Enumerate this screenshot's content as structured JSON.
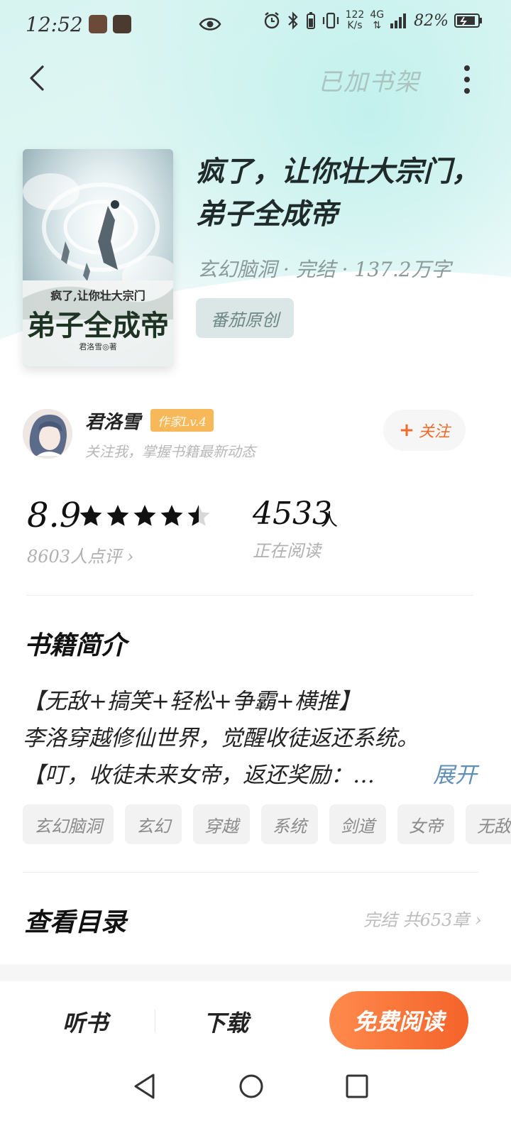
{
  "status_bar": {
    "time": "12:52",
    "speed_value": "122",
    "speed_unit": "K/s",
    "network": "4G",
    "battery": "82%"
  },
  "nav": {
    "shelf_label": "已加书架"
  },
  "book": {
    "title": "疯了，让你壮大宗门，弟子全成帝",
    "meta": "玄幻脑洞 · 完结 · 137.2万字",
    "badge": "番茄原创",
    "cover": {
      "subtitle": "疯了,让你壮大宗门",
      "main_title": "弟子全成帝",
      "author_line": "君洛雪◎著"
    }
  },
  "author": {
    "name": "君洛雪",
    "level": "作家Lv.4",
    "subtitle": "关注我，掌握书籍最新动态",
    "follow_label": "关注"
  },
  "stats": {
    "rating": "8.9",
    "rating_stars": 4.5,
    "rating_count": "8603人点评",
    "readers": "4533",
    "readers_unit": "人",
    "readers_label": "正在阅读"
  },
  "synopsis": {
    "heading": "书籍简介",
    "line1": "【无敌+搞笑+轻松+争霸+横推】",
    "line2": "李洛穿越修仙世界，觉醒收徒返还系统。",
    "line3": "【叮，收徒未来女帝，返还奖励：…",
    "expand_label": "展开"
  },
  "tags": [
    "玄幻脑洞",
    "玄幻",
    "穿越",
    "系统",
    "剑道",
    "女帝",
    "无敌"
  ],
  "toc": {
    "heading": "查看目录",
    "status": "完结 共653章"
  },
  "bottom_bar": {
    "listen_label": "听书",
    "download_label": "下载",
    "read_label": "免费阅读"
  },
  "colors": {
    "accent": "#f4632a",
    "link": "#5f8fb8",
    "level_badge": "#f7b85a"
  }
}
